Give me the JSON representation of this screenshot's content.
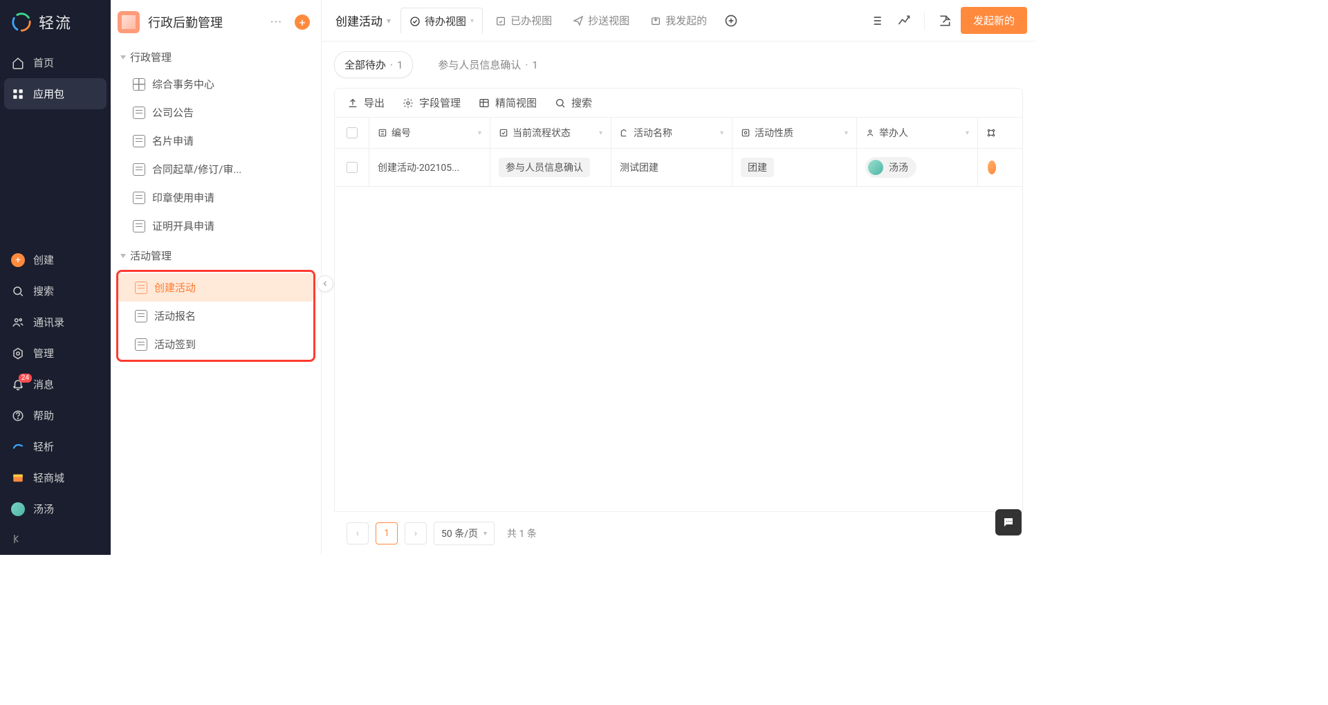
{
  "brand": {
    "text": "轻流"
  },
  "leftnav": {
    "home": "首页",
    "apps": "应用包",
    "create": "创建",
    "search": "搜索",
    "contacts": "通讯录",
    "manage": "管理",
    "messages": "消息",
    "messages_badge": "24",
    "help": "帮助",
    "analysis": "轻析",
    "store": "轻商城",
    "user": "汤汤"
  },
  "secondary": {
    "title": "行政后勤管理",
    "groups": [
      {
        "name": "行政管理",
        "items": [
          {
            "label": "综合事务中心",
            "icon": "grid"
          },
          {
            "label": "公司公告",
            "icon": "doc"
          },
          {
            "label": "名片申请",
            "icon": "doc"
          },
          {
            "label": "合同起草/修订/审...",
            "icon": "doc"
          },
          {
            "label": "印章使用申请",
            "icon": "doc"
          },
          {
            "label": "证明开具申请",
            "icon": "doc"
          }
        ]
      },
      {
        "name": "活动管理",
        "items": [
          {
            "label": "创建活动",
            "icon": "doc",
            "active": true
          },
          {
            "label": "活动报名",
            "icon": "doc"
          },
          {
            "label": "活动签到",
            "icon": "doc"
          }
        ]
      }
    ]
  },
  "header": {
    "dd_label": "创建活动",
    "views": [
      {
        "label": "待办视图",
        "active": true,
        "icon": "check-circle"
      },
      {
        "label": "已办视图",
        "icon": "calendar-check"
      },
      {
        "label": "抄送视图",
        "icon": "send"
      },
      {
        "label": "我发起的",
        "icon": "outbox"
      }
    ],
    "add_view_aria": "添加视图",
    "btn_primary": "发起新的"
  },
  "filters": [
    {
      "label": "全部待办",
      "count": "1",
      "active": true
    },
    {
      "label": "参与人员信息确认",
      "count": "1"
    }
  ],
  "toolbar": {
    "export": "导出",
    "fields": "字段管理",
    "compact": "精简视图",
    "search": "搜索"
  },
  "columns": {
    "id": "编号",
    "status": "当前流程状态",
    "name": "活动名称",
    "type": "活动性质",
    "organizer": "举办人"
  },
  "rows": [
    {
      "id": "创建活动-202105...",
      "status": "参与人员信息确认",
      "name": "测试团建",
      "type": "团建",
      "organizer": "汤汤"
    }
  ],
  "pager": {
    "page": "1",
    "per_page": "50 条/页",
    "total": "共 1 条"
  }
}
